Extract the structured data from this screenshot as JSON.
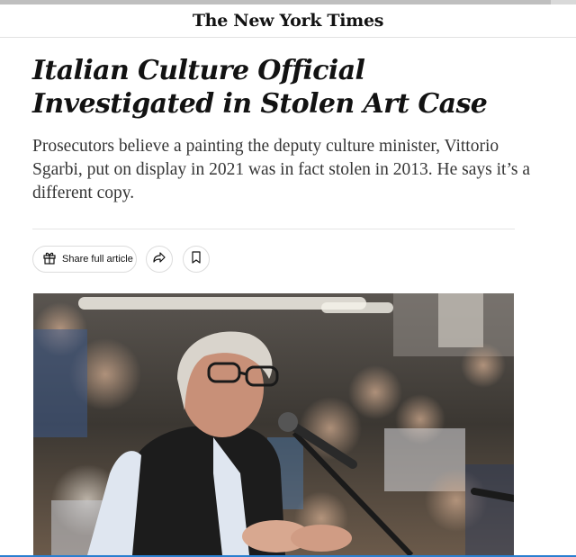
{
  "masthead": {
    "logo_text": "The New York Times"
  },
  "article": {
    "headline": "Italian Culture Official Investigated in Stolen Art Case",
    "summary": "Prosecutors believe a painting the deputy culture minister, Vittorio Sgarbi, put on display in 2021 was in fact stolen in 2013. He says it’s a different copy."
  },
  "toolbar": {
    "share_label": "Share full article",
    "share_icon": "gift-icon",
    "forward_icon": "share-arrow-icon",
    "bookmark_icon": "bookmark-icon"
  },
  "colors": {
    "text": "#121212",
    "summary_text": "#363636",
    "border": "#dcdcdc"
  }
}
